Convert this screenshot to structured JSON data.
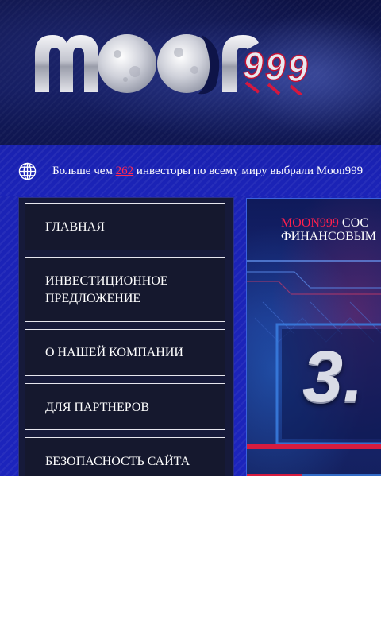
{
  "header": {
    "logo_text": "moon999"
  },
  "ticker": {
    "prefix": "Больше чем",
    "count": "262",
    "suffix": "инвесторы по всему миру выбрали Moon999"
  },
  "menu": {
    "items": [
      {
        "label": "ГЛАВНАЯ"
      },
      {
        "label_line1": "ИНВЕСТИЦИОННОЕ",
        "label_line2": "ПРЕДЛОЖЕНИЕ"
      },
      {
        "label": "О НАШЕЙ КОМПАНИИ"
      },
      {
        "label": "ДЛЯ ПАРТНЕРОВ"
      },
      {
        "label": "БЕЗОПАСНОСТЬ САЙТА"
      }
    ]
  },
  "banner": {
    "brand": "MOON999",
    "title_rest": "СОС",
    "title_line2": "ФИНАНСОВЫМ",
    "big_number": "3."
  },
  "colors": {
    "accent_red": "#ff1f4d",
    "menu_bg": "#15182e",
    "band_blue": "#1b23b8",
    "header_navy": "#0d1245"
  }
}
